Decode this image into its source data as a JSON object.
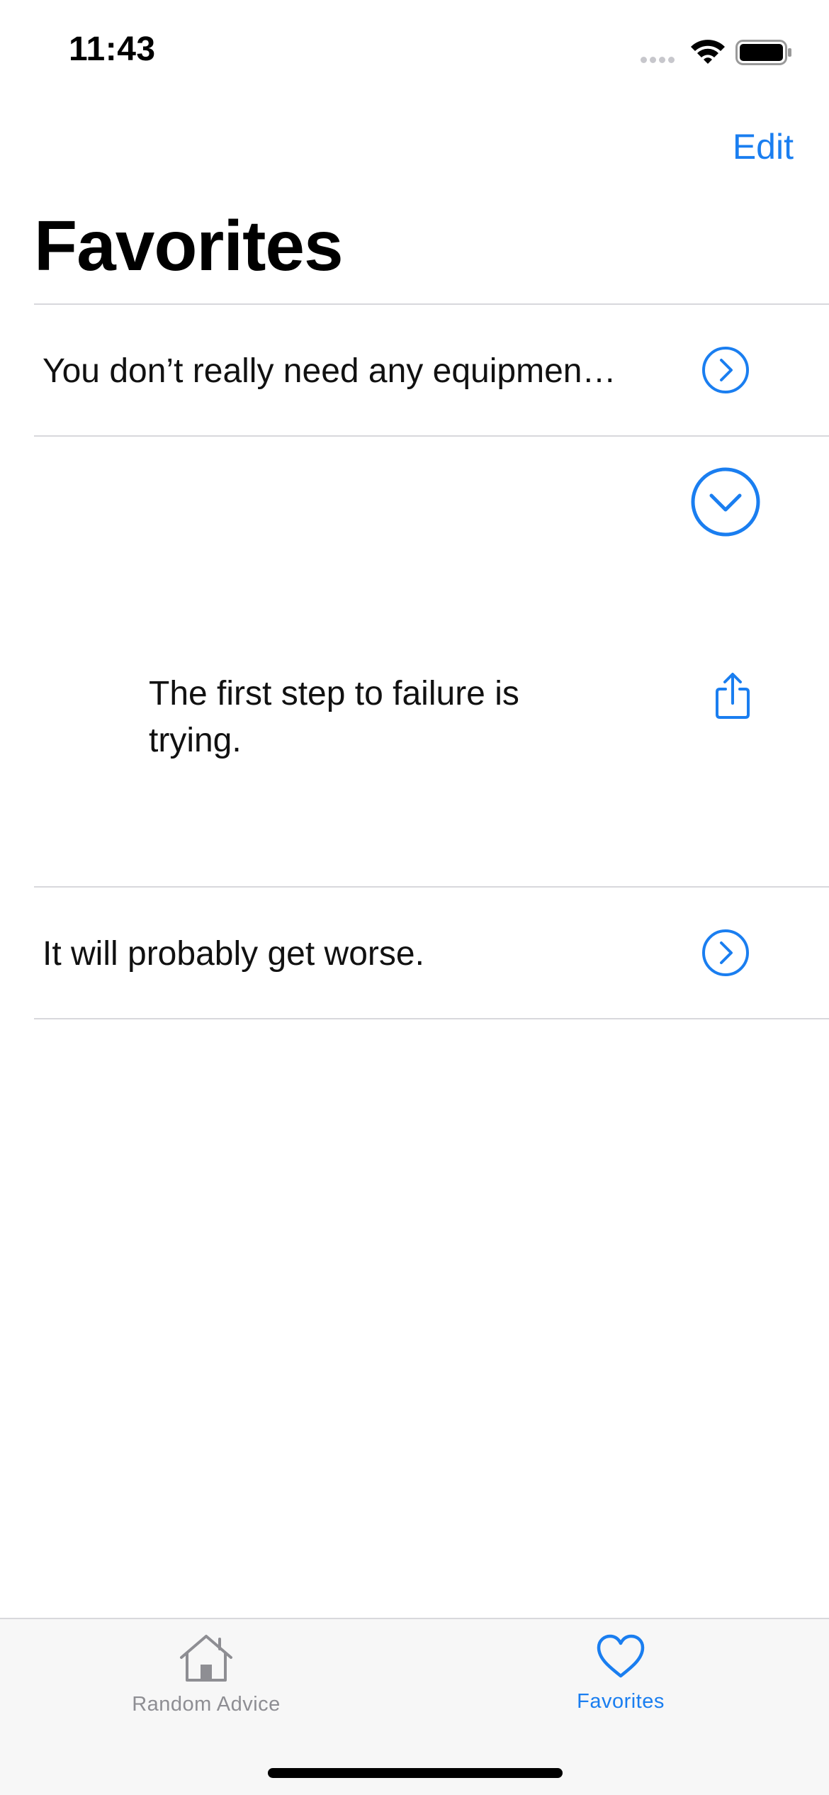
{
  "status_bar": {
    "time": "11:43"
  },
  "nav": {
    "edit_label": "Edit",
    "title": "Favorites"
  },
  "favorites": [
    {
      "text": "You don’t really need any equipmen…",
      "expanded": false
    },
    {
      "text": "The first step to failure is trying.",
      "expanded": true
    },
    {
      "text": "It will probably get worse.",
      "expanded": false
    }
  ],
  "tab_bar": {
    "tabs": [
      {
        "label": "Random Advice",
        "icon": "house-icon",
        "selected": false
      },
      {
        "label": "Favorites",
        "icon": "heart-icon",
        "selected": true
      }
    ]
  },
  "colors": {
    "accent": "#1a7ef0",
    "inactive": "#8e8e93",
    "separator": "#d8d8dc",
    "tab_bar_bg": "#f7f7f7"
  }
}
